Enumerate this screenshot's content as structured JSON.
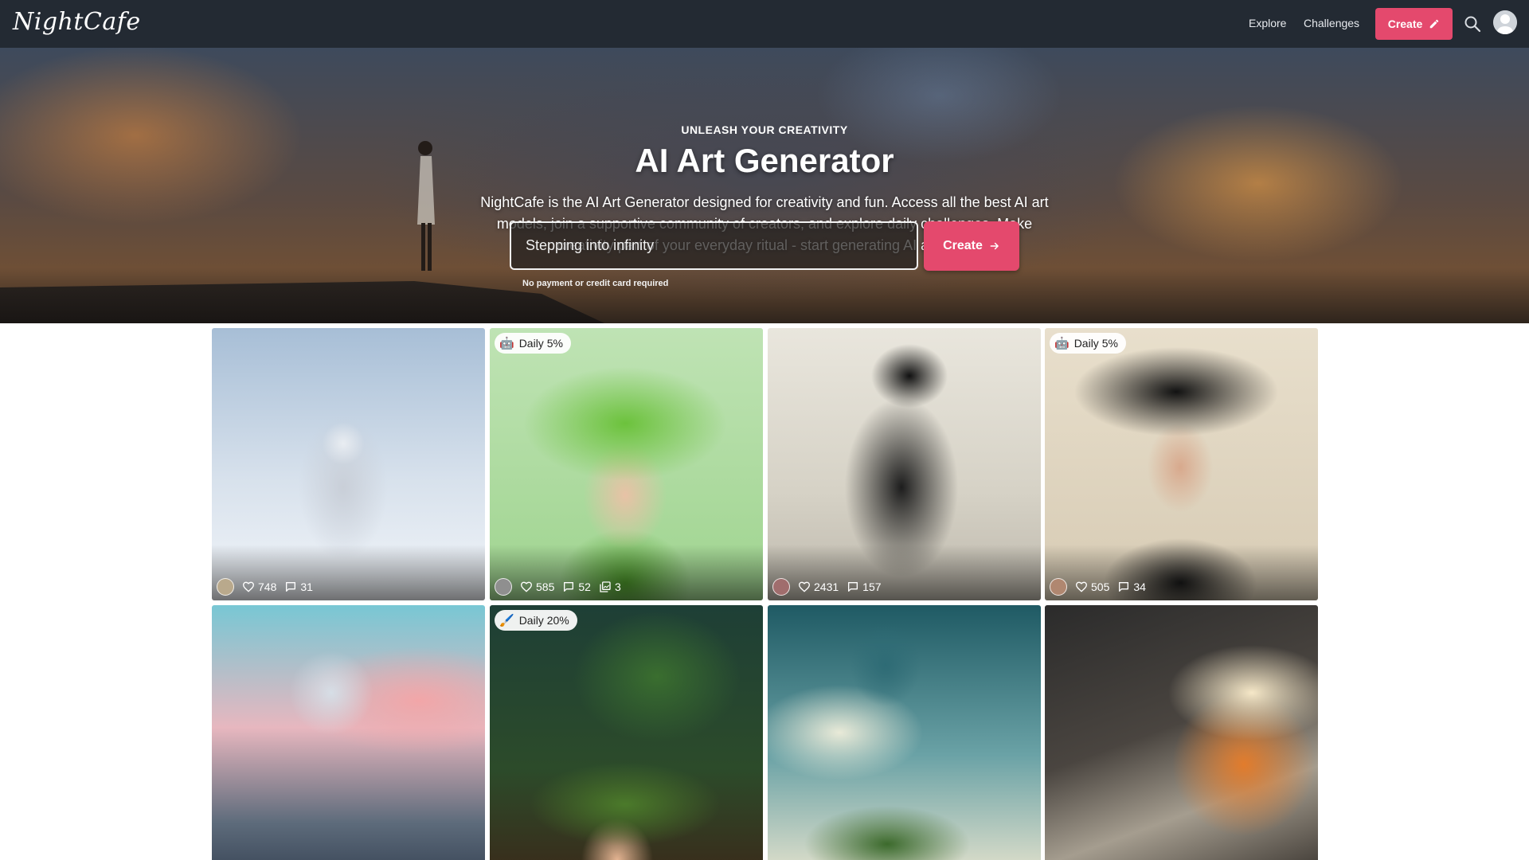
{
  "brand": {
    "logo_text": "NightCafe"
  },
  "nav": {
    "explore_label": "Explore",
    "challenges_label": "Challenges",
    "create_label": "Create",
    "search_icon": "search-icon",
    "avatar_icon": "avatar"
  },
  "hero": {
    "eyebrow": "UNLEASH YOUR CREATIVITY",
    "title": "AI Art Generator",
    "description": "NightCafe is the AI Art Generator designed for creativity and fun. Access all the best AI art models, join a supportive community of creators, and explore daily challenges. Make creativity part of your everyday ritual - start generating AI art now!",
    "prompt_value": "Stepping into infinity",
    "create_label": "Create",
    "note": "No payment or credit card required"
  },
  "colors": {
    "accent": "#e4496d",
    "header_bg": "#232a33"
  },
  "gallery": {
    "cards": [
      {
        "subject": "snow lynx",
        "badge": "",
        "likes": "748",
        "comments": "31",
        "images": "",
        "avatar_color": "#b9a98c"
      },
      {
        "subject": "woman with cabbage hat",
        "badge_icon": "robot-icon",
        "badge": "Daily 5%",
        "likes": "585",
        "comments": "52",
        "images": "3",
        "avatar_color": "#8f8f8f"
      },
      {
        "subject": "ink black cat",
        "badge": "",
        "likes": "2431",
        "comments": "157",
        "images": "",
        "avatar_color": "#a06d6d"
      },
      {
        "subject": "woman with vinyl record hat",
        "badge_icon": "robot-icon",
        "badge": "Daily 5%",
        "likes": "505",
        "comments": "34",
        "images": "",
        "avatar_color": "#b08770"
      },
      {
        "subject": "girl on crescent moon",
        "badge": "",
        "likes": "",
        "comments": "",
        "images": "",
        "avatar_color": "#c48f7a"
      },
      {
        "subject": "girl with forest hat",
        "badge_icon": "paintbrush-icon",
        "badge": "Daily 20%",
        "likes": "",
        "comments": "",
        "images": "",
        "avatar_color": "#7d8c5a"
      },
      {
        "subject": "hot air balloon with floating island",
        "badge": "",
        "likes": "",
        "comments": "",
        "images": "",
        "avatar_color": "#9a8a7a"
      },
      {
        "subject": "ballerina on stage",
        "badge": "",
        "likes": "",
        "comments": "",
        "images": "",
        "avatar_color": "#8a6a5a"
      }
    ]
  }
}
